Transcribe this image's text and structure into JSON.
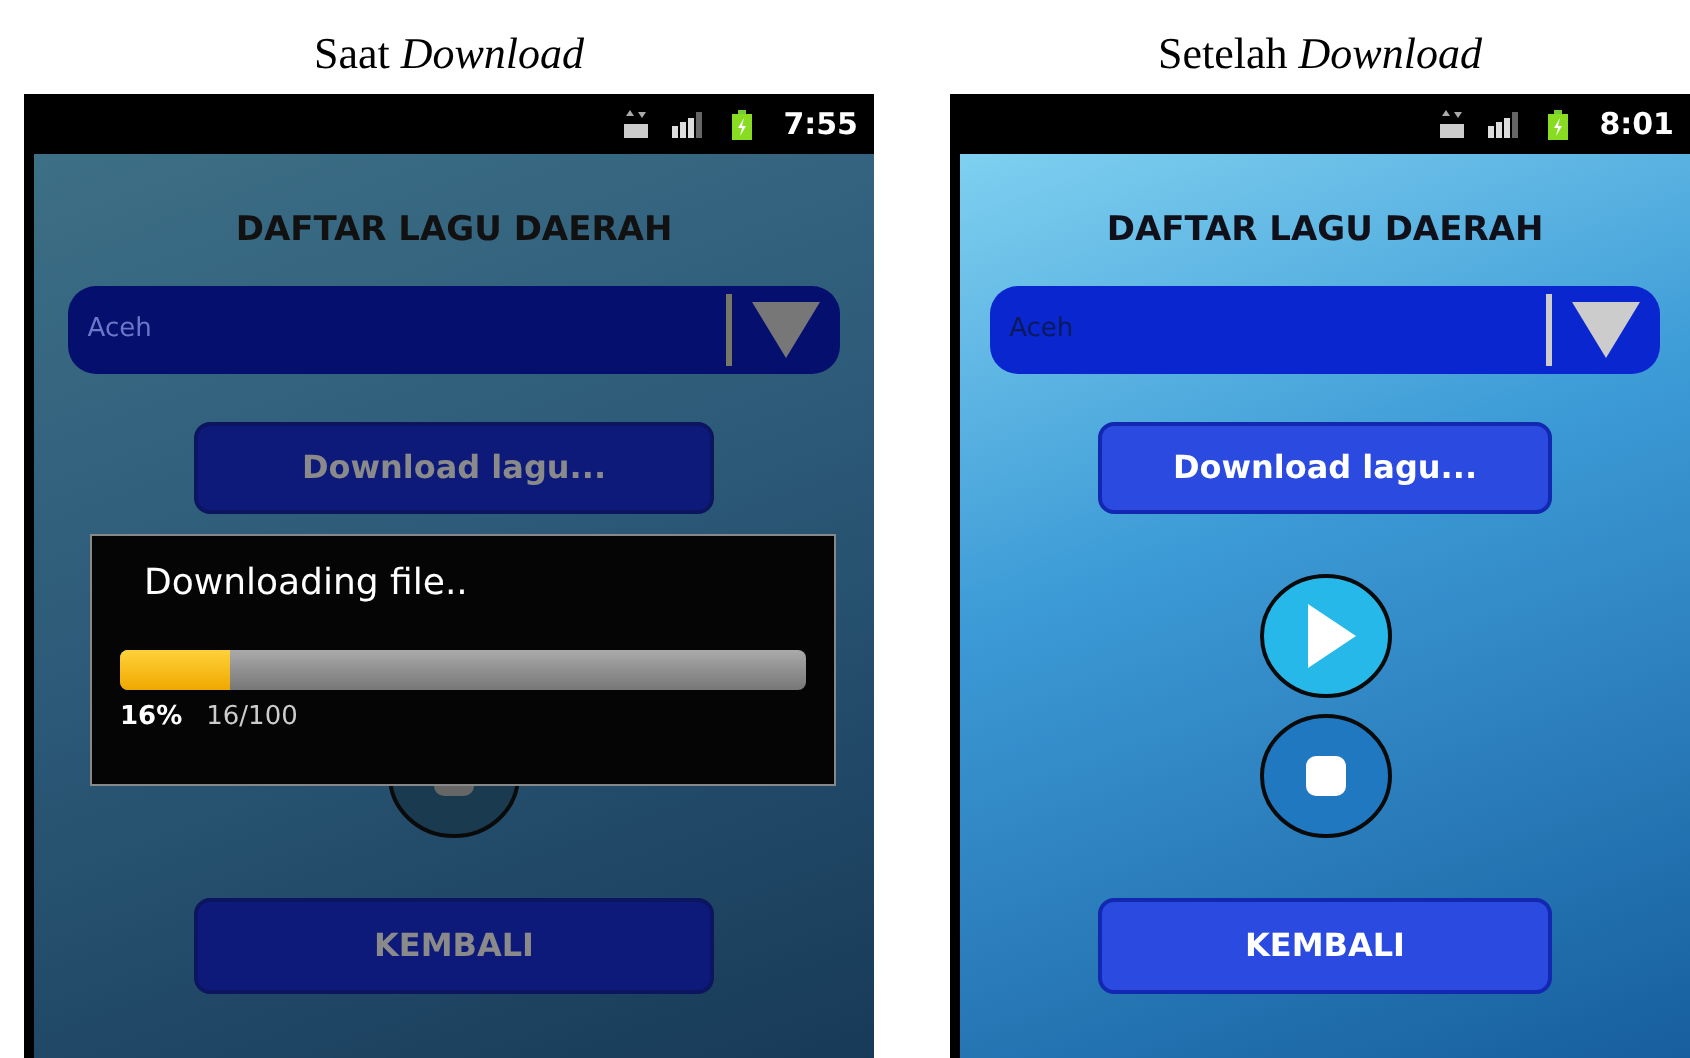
{
  "screens": [
    {
      "caption": "Saat *Download*",
      "dimmed": true,
      "status_bar": {
        "time": "7:55"
      },
      "title": "DAFTAR LAGU DAERAH",
      "dropdown": {
        "value": "Aceh"
      },
      "download_button": "Download lagu...",
      "back_button": "KEMBALI",
      "dialog": {
        "message": "Downloading file..",
        "level": 0.16,
        "percent": "16%",
        "count": "16/100"
      }
    },
    {
      "caption": "Setelah *Download*",
      "dimmed": false,
      "status_bar": {
        "time": "8:01"
      },
      "title": "DAFTAR LAGU DAERAH",
      "dropdown": {
        "value": "Aceh"
      },
      "download_button": "Download lagu...",
      "back_button": "KEMBALI"
    }
  ]
}
